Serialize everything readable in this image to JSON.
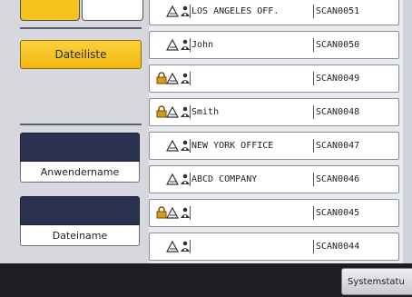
{
  "left": {
    "file_list_label": "Dateiliste",
    "user_name_label": "Anwendername",
    "file_name_label": "Dateiname"
  },
  "files": [
    {
      "name": "LOS ANGELES OFF.",
      "file": "SCAN0051",
      "lock": false
    },
    {
      "name": "John",
      "file": "SCAN0050",
      "lock": false
    },
    {
      "name": "",
      "file": "SCAN0049",
      "lock": true
    },
    {
      "name": "Smith",
      "file": "SCAN0048",
      "lock": true
    },
    {
      "name": "NEW YORK OFFICE",
      "file": "SCAN0047",
      "lock": false
    },
    {
      "name": "ABCD COMPANY",
      "file": "SCAN0046",
      "lock": false
    },
    {
      "name": "",
      "file": "SCAN0045",
      "lock": true
    },
    {
      "name": "",
      "file": "SCAN0044",
      "lock": false
    }
  ],
  "bottom": {
    "status_label": "Systemstatu"
  },
  "colors": {
    "accent": "#f7c21b",
    "panel_dark": "#2b3150",
    "bar": "#1d1d22"
  },
  "icons": {
    "lock": "lock-icon",
    "user": "user-icon",
    "document": "document-icon"
  }
}
